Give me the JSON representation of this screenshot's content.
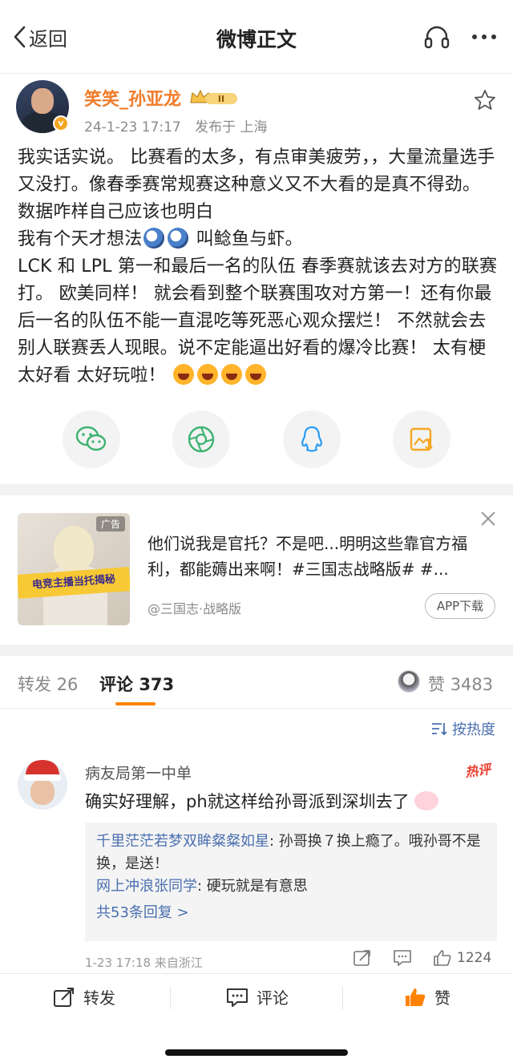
{
  "nav": {
    "back_label": "返回",
    "title": "微博正文",
    "icons": [
      "headphone-icon",
      "more-icon"
    ]
  },
  "post": {
    "author": "笑笑_孙亚龙",
    "badge": "II",
    "date": "24-1-23 17:17",
    "location": "发布于 上海",
    "text_1": "我实话实说。 比赛看的太多，有点审美疲劳，，大量流量选手又没打。像春季赛常规赛这种意义又不大看的是真不得劲。 数据咋样自己应该也明白",
    "text_2a": "我有个天才想法",
    "text_2b": "叫鲶鱼与虾。",
    "text_3": "LCK 和 LPL 第一和最后一名的队伍 春季赛就该去对方的联赛打。 欧美同样！ 就会看到整个联赛围攻对方第一！还有你最后一名的队伍不能一直混吃等死恶心观众摆烂！ 不然就会去别人联赛丢人现眼。说不定能逼出好看的爆冷比赛！ 太有梗 太好看 太好玩啦！",
    "share_icons": [
      "wechat-icon",
      "moments-icon",
      "qq-icon",
      "save-image-icon"
    ]
  },
  "ad": {
    "tag": "广告",
    "banner": "电竞主播当托揭秘",
    "text": "他们说我是官托？不是吧...明明这些靠官方福利，都能薅出来啊！#三国志战略版# #...",
    "source": "@三国志·战略版",
    "download": "APP下载"
  },
  "tabs": {
    "repost_label": "转发",
    "repost_count": "26",
    "comment_label": "评论",
    "comment_count": "373",
    "like_label": "赞",
    "like_count": "3483"
  },
  "sort_label": "按热度",
  "comment": {
    "name": "病友局第一中单",
    "hot_badge": "热评",
    "text": "确实好理解，ph就这样给孙哥派到深圳去了",
    "replies": [
      {
        "name": "千里茫茫若梦双眸粲粲如星",
        "text": ": 孙哥换７换上瘾了。哦孙哥不是换，是送！"
      },
      {
        "name": "网上冲浪张同学",
        "text": ": 硬玩就是有意思"
      }
    ],
    "more_replies": "共53条回复 >",
    "date": "1-23 17:18",
    "location": "来自浙江",
    "like_count": "1224"
  },
  "bottom": {
    "repost": "转发",
    "comment": "评论",
    "like": "赞"
  },
  "colors": {
    "accent": "#ff8200",
    "author": "#f07c2a",
    "link": "#4a6fb0",
    "hot": "#e8412f"
  }
}
